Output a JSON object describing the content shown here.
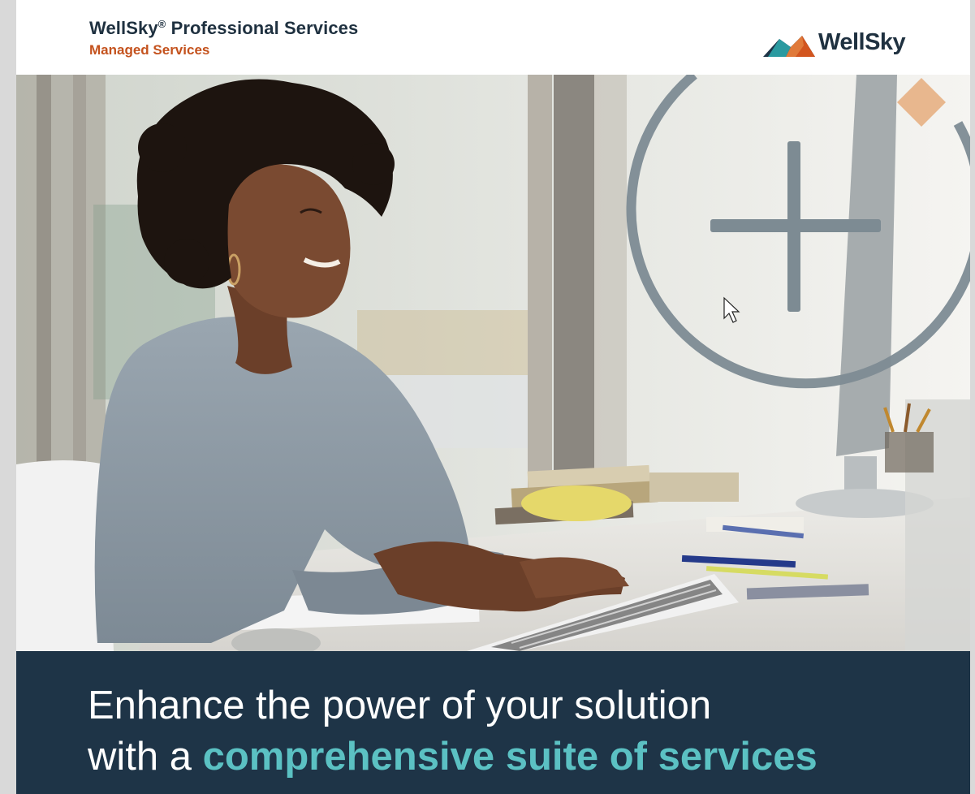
{
  "header": {
    "brand": "WellSky",
    "brand_mark": "®",
    "brand_rest": " Professional Services",
    "subtitle": "Managed Services",
    "logo_text": "WellSky",
    "logo_icon": "wellsky-mountain-logo-icon"
  },
  "hero": {
    "image_description_icon": "woman-at-computer-photo",
    "overlay_icon": "plus-circle-graphic"
  },
  "banner": {
    "line1": "Enhance the power of your solution",
    "line2_prefix": "with a ",
    "line2_highlight": "comprehensive suite of services"
  },
  "colors": {
    "navy": "#1e3447",
    "orange": "#c4521d",
    "teal": "#5bc1c3",
    "peach": "#e8b78e"
  }
}
